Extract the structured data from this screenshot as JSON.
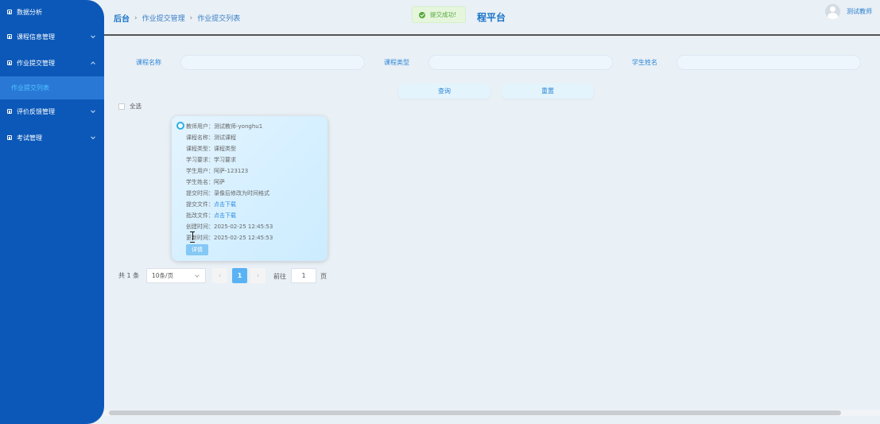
{
  "sidebar": {
    "items": [
      {
        "label": "数据分析"
      },
      {
        "label": "课程信息管理"
      },
      {
        "label": "作业提交管理"
      },
      {
        "label": "评价反馈管理"
      },
      {
        "label": "考试管理"
      }
    ],
    "active_submenu": "作业提交列表"
  },
  "header": {
    "breadcrumb": [
      "后台",
      "作业提交管理",
      "作业提交列表"
    ],
    "site_title": "程平台",
    "toast": "提交成功!",
    "username": "测试教师"
  },
  "search": {
    "course_name_label": "课程名称",
    "course_type_label": "课程类型",
    "student_name_label": "学生姓名",
    "query_button": "查询",
    "reset_button": "重置"
  },
  "select_all": "全选",
  "card": {
    "rows": [
      {
        "key": "教师用户：",
        "value": "测试教师-yonghu1"
      },
      {
        "key": "课程名称：",
        "value": "测试课程"
      },
      {
        "key": "课程类型：",
        "value": "课程类型"
      },
      {
        "key": "学习要求：",
        "value": "学习要求"
      },
      {
        "key": "学生用户：",
        "value": "阿萨-123123"
      },
      {
        "key": "学生姓名：",
        "value": "阿萨"
      },
      {
        "key": "提交时间：",
        "value": "录像后修改为时间格式"
      },
      {
        "key": "提交文件：",
        "value": "点击下载"
      },
      {
        "key": "批改文件：",
        "value": "点击下载"
      },
      {
        "key": "创建时间：",
        "value": "2025-02-25 12:45:53"
      },
      {
        "key": "更新时间：",
        "value": "2025-02-25 12:45:53"
      }
    ],
    "detail_button": "详情"
  },
  "pagination": {
    "total": "共 1 条",
    "page_size": "10条/页",
    "current_page": "1",
    "goto_label": "前往",
    "goto_value": "1",
    "unit": "页"
  }
}
